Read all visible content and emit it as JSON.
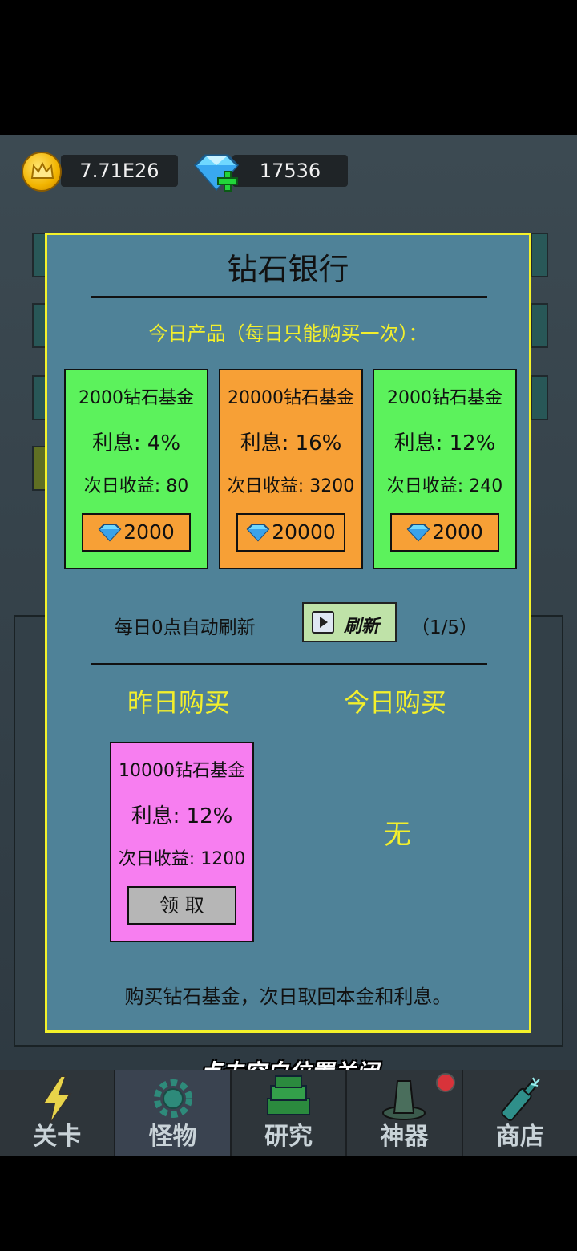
{
  "topbar": {
    "coins": "7.71E26",
    "diamonds": "17536",
    "coin_icon": "crown-coin-icon",
    "diamond_icon": "diamond-plus-icon"
  },
  "modal": {
    "title": "钻石银行",
    "products_header": "今日产品（每日只能购买一次）：",
    "products": [
      {
        "name": "2000钻石基金",
        "rate": "利息: 4%",
        "income": "次日收益: 80",
        "price": "2000",
        "color": "#5cf25c"
      },
      {
        "name": "20000钻石基金",
        "rate": "利息: 16%",
        "income": "次日收益: 3200",
        "price": "20000",
        "color": "#f7a036"
      },
      {
        "name": "2000钻石基金",
        "rate": "利息: 12%",
        "income": "次日收益: 240",
        "price": "2000",
        "color": "#5cf25c"
      }
    ],
    "refresh_note": "每日0点自动刷新",
    "refresh_label": "刷新",
    "refresh_count": "（1/5）",
    "yesterday_title": "昨日购买",
    "today_title": "今日购买",
    "yesterday_item": {
      "name": "10000钻石基金",
      "rate": "利息: 12%",
      "income": "次日收益: 1200",
      "claim_label": "领 取",
      "color": "#f77ef0"
    },
    "today_empty": "无",
    "footer_note": "购买钻石基金，次日取回本金和利息。"
  },
  "close_hint": "点击空白位置关闭",
  "nav": {
    "tabs": [
      {
        "label": "关卡",
        "icon": "lightning-icon"
      },
      {
        "label": "怪物",
        "icon": "gear-icon"
      },
      {
        "label": "研究",
        "icon": "books-icon"
      },
      {
        "label": "神器",
        "icon": "hat-icon"
      },
      {
        "label": "商店",
        "icon": "bottle-icon"
      }
    ]
  }
}
